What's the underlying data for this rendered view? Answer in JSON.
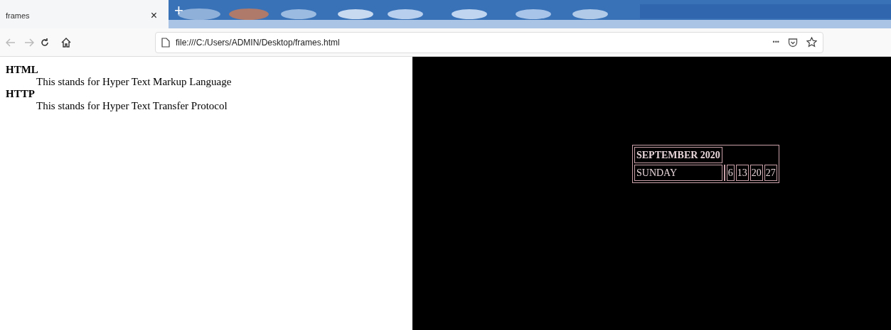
{
  "tab": {
    "title": "frames",
    "close": "×",
    "new_tab": "+"
  },
  "toolbar": {
    "url": "file:///C:/Users/ADMIN/Desktop/frames.html",
    "more": "•••"
  },
  "left_frame": {
    "definitions": [
      {
        "term": "HTML",
        "description": "This stands for Hyper Text Markup Language"
      },
      {
        "term": "HTTP",
        "description": "This stands for Hyper Text Transfer Protocol"
      }
    ]
  },
  "right_frame": {
    "calendar": {
      "month": "SEPTEMBER 2020",
      "day": "SUNDAY",
      "dates": [
        "6",
        "13",
        "20",
        "27"
      ]
    }
  }
}
